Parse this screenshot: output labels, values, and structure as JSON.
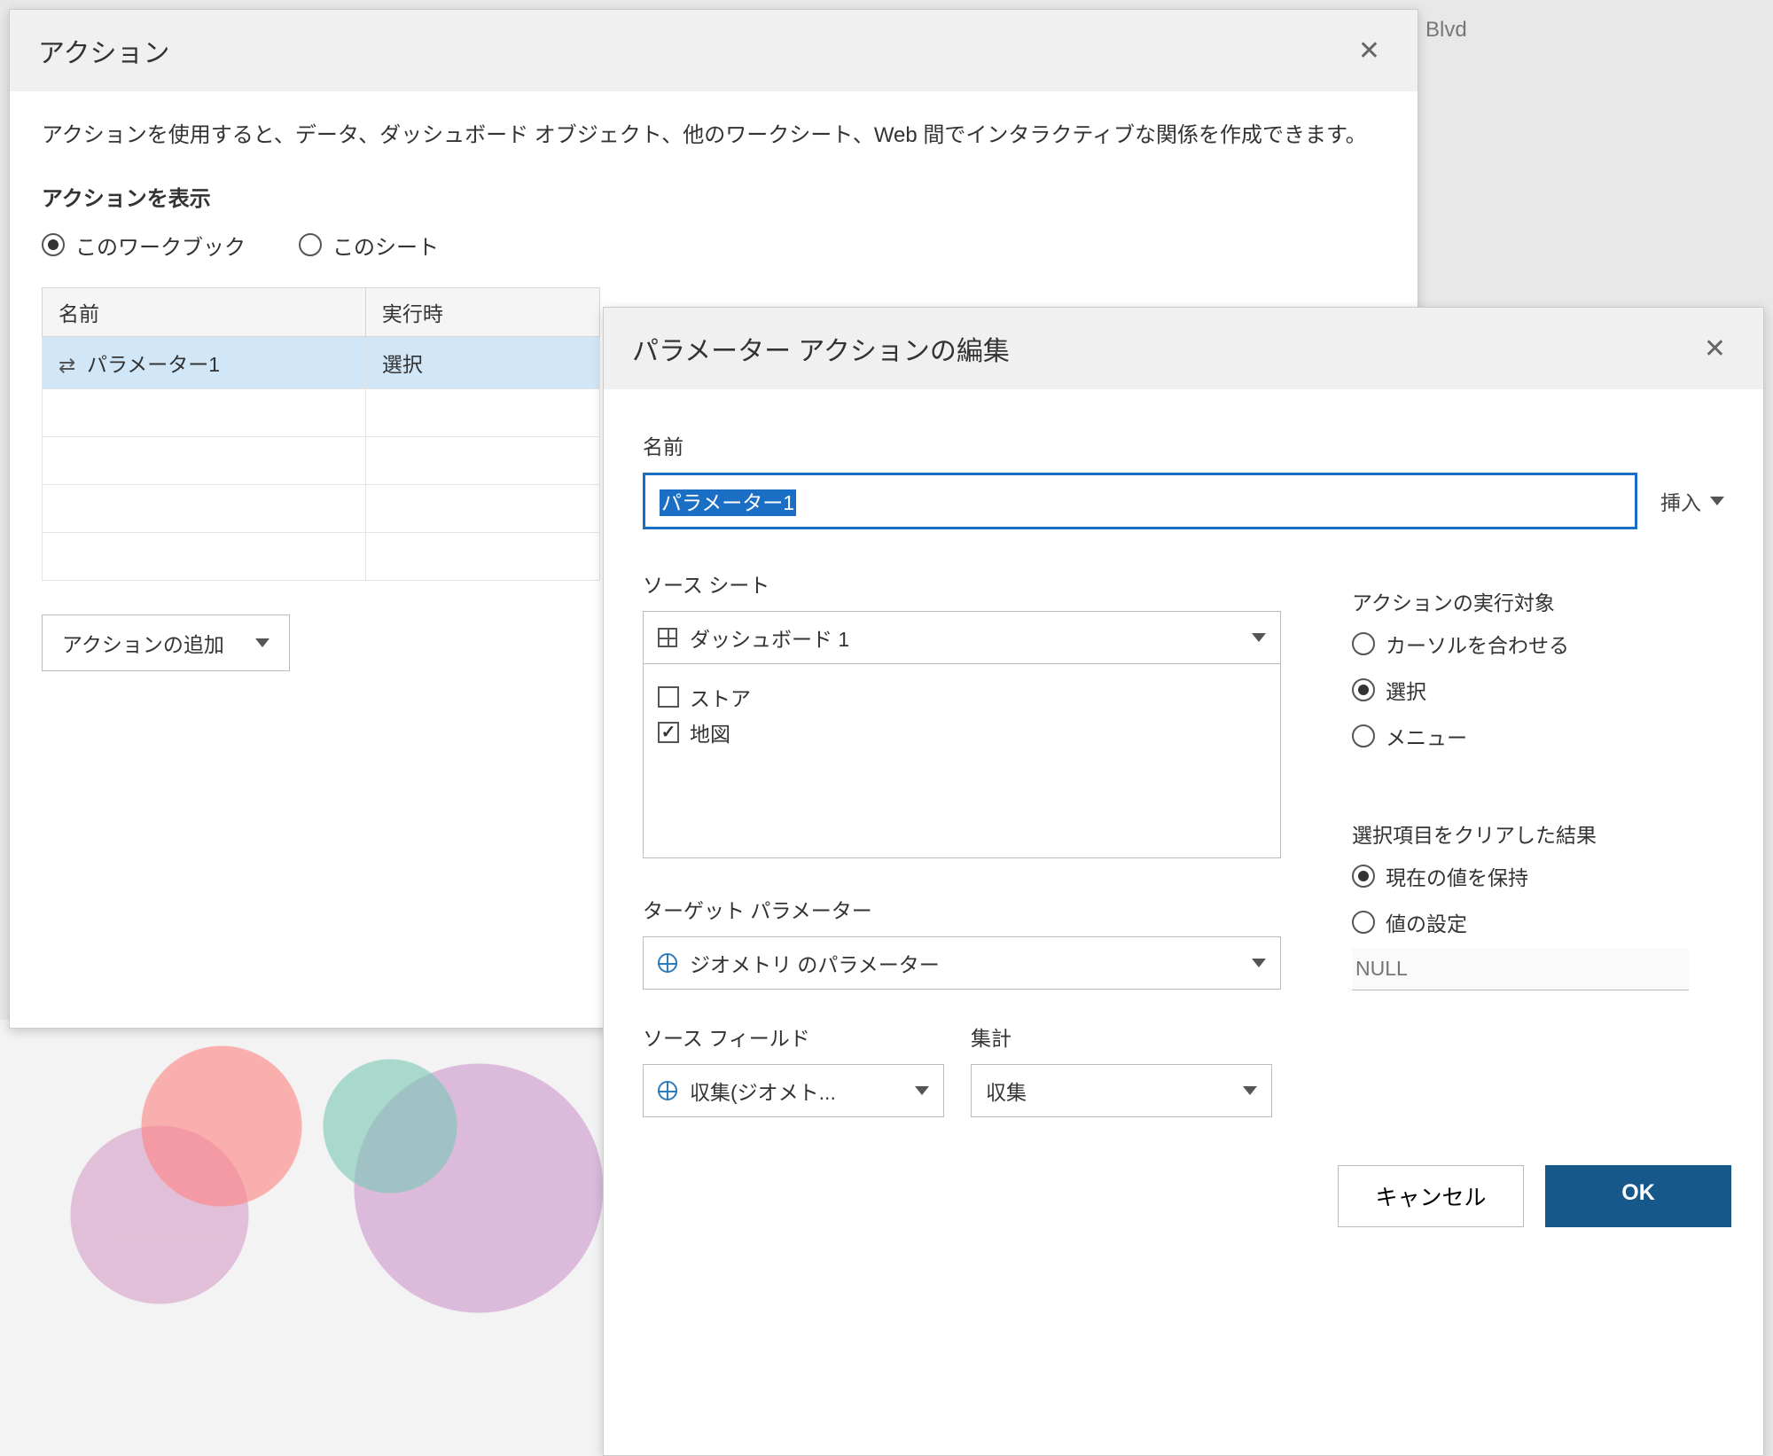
{
  "bg": {
    "street": "Blvd"
  },
  "actionsDialog": {
    "title": "アクション",
    "description": "アクションを使用すると、データ、ダッシュボード オブジェクト、他のワークシート、Web 間でインタラクティブな関係を作成できます。",
    "showActionsLabel": "アクションを表示",
    "scope": {
      "workbook": "このワークブック",
      "sheet": "このシート"
    },
    "table": {
      "headers": {
        "name": "名前",
        "runOn": "実行時"
      },
      "rows": [
        {
          "name": "パラメーター1",
          "runOn": "選択"
        }
      ]
    },
    "addAction": "アクションの追加"
  },
  "editDialog": {
    "title": "パラメーター アクションの編集",
    "nameLabel": "名前",
    "nameValue": "パラメーター1",
    "insert": "挿入",
    "sourceSheetsLabel": "ソース シート",
    "sourceSelect": "ダッシュボード 1",
    "sheets": [
      {
        "label": "ストア",
        "checked": false
      },
      {
        "label": "地図",
        "checked": true
      }
    ],
    "runOnLabel": "アクションの実行対象",
    "runOnOptions": {
      "hover": "カーソルを合わせる",
      "select": "選択",
      "menu": "メニュー"
    },
    "runOnSelected": "select",
    "targetParamLabel": "ターゲット パラメーター",
    "targetParamValue": "ジオメトリ のパラメーター",
    "sourceFieldLabel": "ソース フィールド",
    "sourceFieldValue": "収集(ジオメト...",
    "aggLabel": "集計",
    "aggValue": "収集",
    "clearLabel": "選択項目をクリアした結果",
    "clearOptions": {
      "keep": "現在の値を保持",
      "set": "値の設定"
    },
    "clearSelected": "keep",
    "nullPlaceholder": "NULL",
    "buttons": {
      "cancel": "キャンセル",
      "ok": "OK"
    }
  }
}
